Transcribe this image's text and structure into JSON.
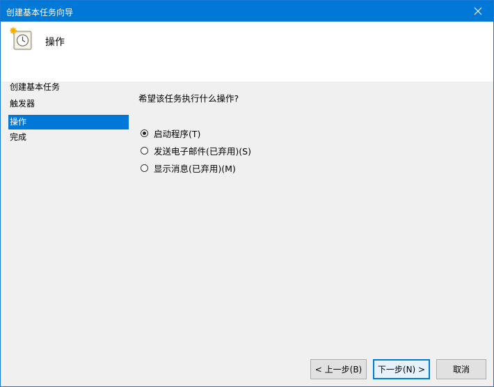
{
  "window": {
    "title": "创建基本任务向导"
  },
  "header": {
    "title": "操作",
    "icon": "scheduled-task-clock-icon"
  },
  "nav": {
    "items": [
      {
        "label": "创建基本任务",
        "active": false
      },
      {
        "label": "触发器",
        "active": false
      },
      {
        "label": "操作",
        "active": true
      },
      {
        "label": "完成",
        "active": false
      }
    ]
  },
  "main": {
    "question": "希望该任务执行什么操作?",
    "options": [
      {
        "label": "启动程序(T)",
        "checked": true
      },
      {
        "label": "发送电子邮件(已弃用)(S)",
        "checked": false
      },
      {
        "label": "显示消息(已弃用)(M)",
        "checked": false
      }
    ]
  },
  "buttons": {
    "back": "< 上一步(B)",
    "next": "下一步(N) >",
    "cancel": "取消"
  },
  "colors": {
    "accent": "#0078d7",
    "background": "#f0f0f0"
  }
}
